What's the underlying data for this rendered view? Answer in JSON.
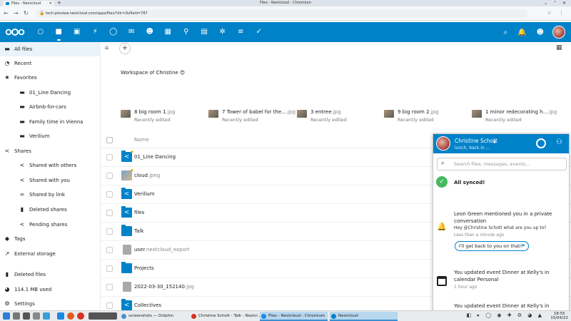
{
  "window": {
    "tab_title": "Files - Nextcloud",
    "title": "Files - Nextcloud - Chromium",
    "url": "tech-preview.nextcloud.com/apps/files/?dir=/&fileid=787"
  },
  "leftnav": {
    "items": [
      {
        "label": "All files",
        "icon": "folder-icon",
        "active": true
      },
      {
        "label": "Recent",
        "icon": "clock-icon"
      },
      {
        "label": "Favorites",
        "icon": "star-icon"
      },
      {
        "label": "01_Line Dancing",
        "icon": "folder-icon",
        "sub": true
      },
      {
        "label": "Airbnb-for-cars",
        "icon": "folder-icon",
        "sub": true
      },
      {
        "label": "Family time in Vienna",
        "icon": "folder-icon",
        "sub": true
      },
      {
        "label": "Verilium",
        "icon": "folder-icon",
        "sub": true
      },
      {
        "label": "Shares",
        "icon": "share-icon"
      },
      {
        "label": "Shared with others",
        "icon": "share-icon",
        "sub": true
      },
      {
        "label": "Shared with you",
        "icon": "share-icon",
        "sub": true
      },
      {
        "label": "Shared by link",
        "icon": "link-icon",
        "sub": true
      },
      {
        "label": "Deleted shares",
        "icon": "trash-icon",
        "sub": true
      },
      {
        "label": "Pending shares",
        "icon": "share-icon",
        "sub": true
      },
      {
        "label": "Tags",
        "icon": "tag-icon"
      },
      {
        "label": "External storage",
        "icon": "external-icon"
      }
    ],
    "bottom": {
      "deleted_files": "Deleted files",
      "usage": "114.1 MB used",
      "settings": "Settings"
    }
  },
  "main": {
    "workspace_text": "Workspace of Christine 😍",
    "recent": [
      {
        "name": "8 big room 1",
        "ext": ".jpg",
        "sub": "Recently edited"
      },
      {
        "name": "7 Tower of babel for the...",
        "ext": ".jpg",
        "sub": "Recently edited"
      },
      {
        "name": "3 entree",
        "ext": ".jpg",
        "sub": "Recently edited"
      },
      {
        "name": "9 big room 2",
        "ext": ".jpg",
        "sub": "Recently edited"
      },
      {
        "name": "1 minor redecorating h...",
        "ext": ".jpg",
        "sub": "Recently edited"
      }
    ],
    "column_name": "Name",
    "files": [
      {
        "name": "01_Line Dancing",
        "ext": "",
        "type": "shared-folder",
        "fav": true
      },
      {
        "name": "cloud",
        "ext": ".jpeg",
        "type": "image",
        "fav": true
      },
      {
        "name": "Verilium",
        "ext": "",
        "type": "shared-folder"
      },
      {
        "name": "files",
        "ext": "",
        "type": "shared-folder"
      },
      {
        "name": "Talk",
        "ext": "",
        "type": "folder"
      },
      {
        "name": "user",
        "ext": ".nextcloud_export",
        "type": "file"
      },
      {
        "name": "Projects",
        "ext": "",
        "type": "folder"
      },
      {
        "name": "2022-03-30_152140",
        "ext": ".jpg",
        "type": "file"
      },
      {
        "name": "Collectives",
        "ext": "",
        "type": "shared-folder"
      }
    ]
  },
  "notifications": {
    "user_name": "Christine Schott",
    "status": "lunch, back in ...",
    "search_placeholder": "Search files, messages, events...",
    "synced": "All synced!",
    "n1_title": "Leon Green mentioned you in a private conversation",
    "n1_message": "Hey @Christine Schott what are you up to?",
    "n1_time": "Less than a minute ago",
    "n1_reply": "I'll get back to you on that!",
    "n2_title": "You updated event Dinner at Kelly's in calendar Personal",
    "n2_time": "1 hour ago",
    "n3_title": "You updated event Dinner at Kelly's in calendar"
  },
  "taskbar": {
    "tasks": [
      {
        "label": "screenshots — Dolphin"
      },
      {
        "label": "Christine Schott - Talk - Nextcl..."
      },
      {
        "label": "Files - Nextcloud - Chromium",
        "active": true
      },
      {
        "label": "Nextcloud"
      }
    ],
    "time": "18:55",
    "date": "15/04/22"
  },
  "colors": {
    "brand": "#0082c9",
    "success": "#46ba61"
  }
}
